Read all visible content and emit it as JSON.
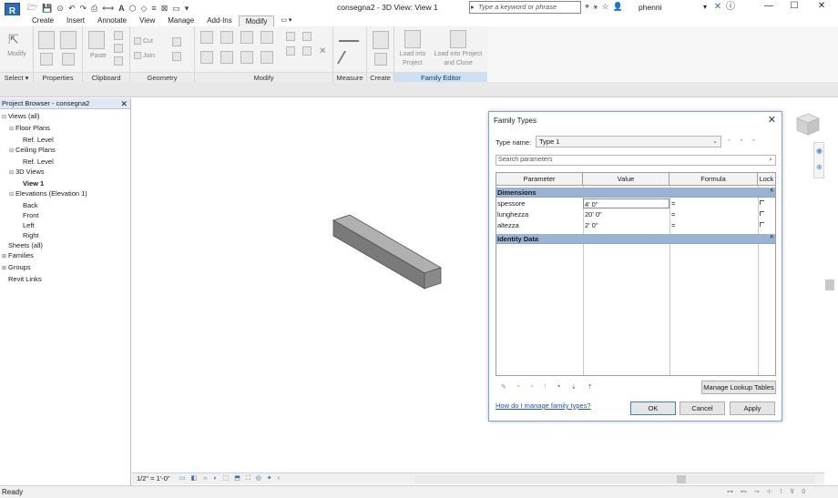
{
  "app": {
    "logo_text": "R",
    "document_title": "consegna2 - 3D View: View 1",
    "search_placeholder": "Type a keyword or phrase",
    "user_name": "phenni"
  },
  "window_controls": {
    "minimize": "—",
    "maximize": "☐",
    "close": "✕"
  },
  "menu_tabs": [
    "Create",
    "Insert",
    "Annotate",
    "View",
    "Manage",
    "Add-Ins",
    "Modify"
  ],
  "active_tab": "Modify",
  "ribbon": {
    "panels": [
      {
        "label": "Select ▾"
      },
      {
        "label": "Properties"
      },
      {
        "label": "Clipboard"
      },
      {
        "label": "Geometry"
      },
      {
        "label": "Modify"
      },
      {
        "label": "Measure"
      },
      {
        "label": "Create"
      },
      {
        "label": "Family Editor"
      }
    ],
    "button_labels": {
      "modify": "Modify",
      "paste": "Paste",
      "cut": "Cut",
      "join": "Join",
      "load_into_project": "Load into Project",
      "load_into_project_and_close": "Load into Project and Close"
    }
  },
  "project_browser": {
    "title": "Project Browser - consegna2",
    "close": "✕",
    "items": [
      {
        "label": "Views (all)",
        "indent": 0,
        "toggle": "⊟"
      },
      {
        "label": "Floor Plans",
        "indent": 1,
        "toggle": "⊟"
      },
      {
        "label": "Ref. Level",
        "indent": 2,
        "toggle": ""
      },
      {
        "label": "Ceiling Plans",
        "indent": 1,
        "toggle": "⊟"
      },
      {
        "label": "Ref. Level",
        "indent": 2,
        "toggle": ""
      },
      {
        "label": "3D Views",
        "indent": 1,
        "toggle": "⊟"
      },
      {
        "label": "View 1",
        "indent": 2,
        "toggle": "",
        "bold": true
      },
      {
        "label": "Elevations (Elevation 1)",
        "indent": 1,
        "toggle": "⊟"
      },
      {
        "label": "Back",
        "indent": 2,
        "toggle": ""
      },
      {
        "label": "Front",
        "indent": 2,
        "toggle": ""
      },
      {
        "label": "Left",
        "indent": 2,
        "toggle": ""
      },
      {
        "label": "Right",
        "indent": 2,
        "toggle": ""
      },
      {
        "label": "Sheets (all)",
        "indent": 0,
        "toggle": ""
      },
      {
        "label": "Families",
        "indent": 0,
        "toggle": "⊞"
      },
      {
        "label": "Groups",
        "indent": 0,
        "toggle": "⊞"
      },
      {
        "label": "Revit Links",
        "indent": 0,
        "toggle": ""
      }
    ]
  },
  "view_control_bar": {
    "scale": "1/2\" = 1'-0\""
  },
  "status_bar": {
    "text": "Ready",
    "filter_count": "0"
  },
  "dialog": {
    "title": "Family Types",
    "type_name_label": "Type name:",
    "type_name_value": "Type 1",
    "search_placeholder": "Search parameters",
    "columns": [
      "Parameter",
      "Value",
      "Formula",
      "Lock"
    ],
    "groups": [
      {
        "name": "Dimensions",
        "rows": [
          {
            "parameter": "spessore",
            "value": "4'  0\"",
            "formula": "="
          },
          {
            "parameter": "lunghezza",
            "value": "20'  0\"",
            "formula": "="
          },
          {
            "parameter": "altezza",
            "value": "2'  0\"",
            "formula": "="
          }
        ]
      },
      {
        "name": "Identity Data",
        "rows": []
      }
    ],
    "manage_lookup_tables": "Manage Lookup Tables",
    "help_link": "How do I manage family types?",
    "ok": "OK",
    "cancel": "Cancel",
    "apply": "Apply"
  },
  "colors": {
    "group_header": "#9ab3d4",
    "family_editor_panel": "#cde0f3",
    "dialog_border": "#7aa6d8",
    "box_top": "#b0b0b0",
    "box_front": "#7a7a7a"
  }
}
